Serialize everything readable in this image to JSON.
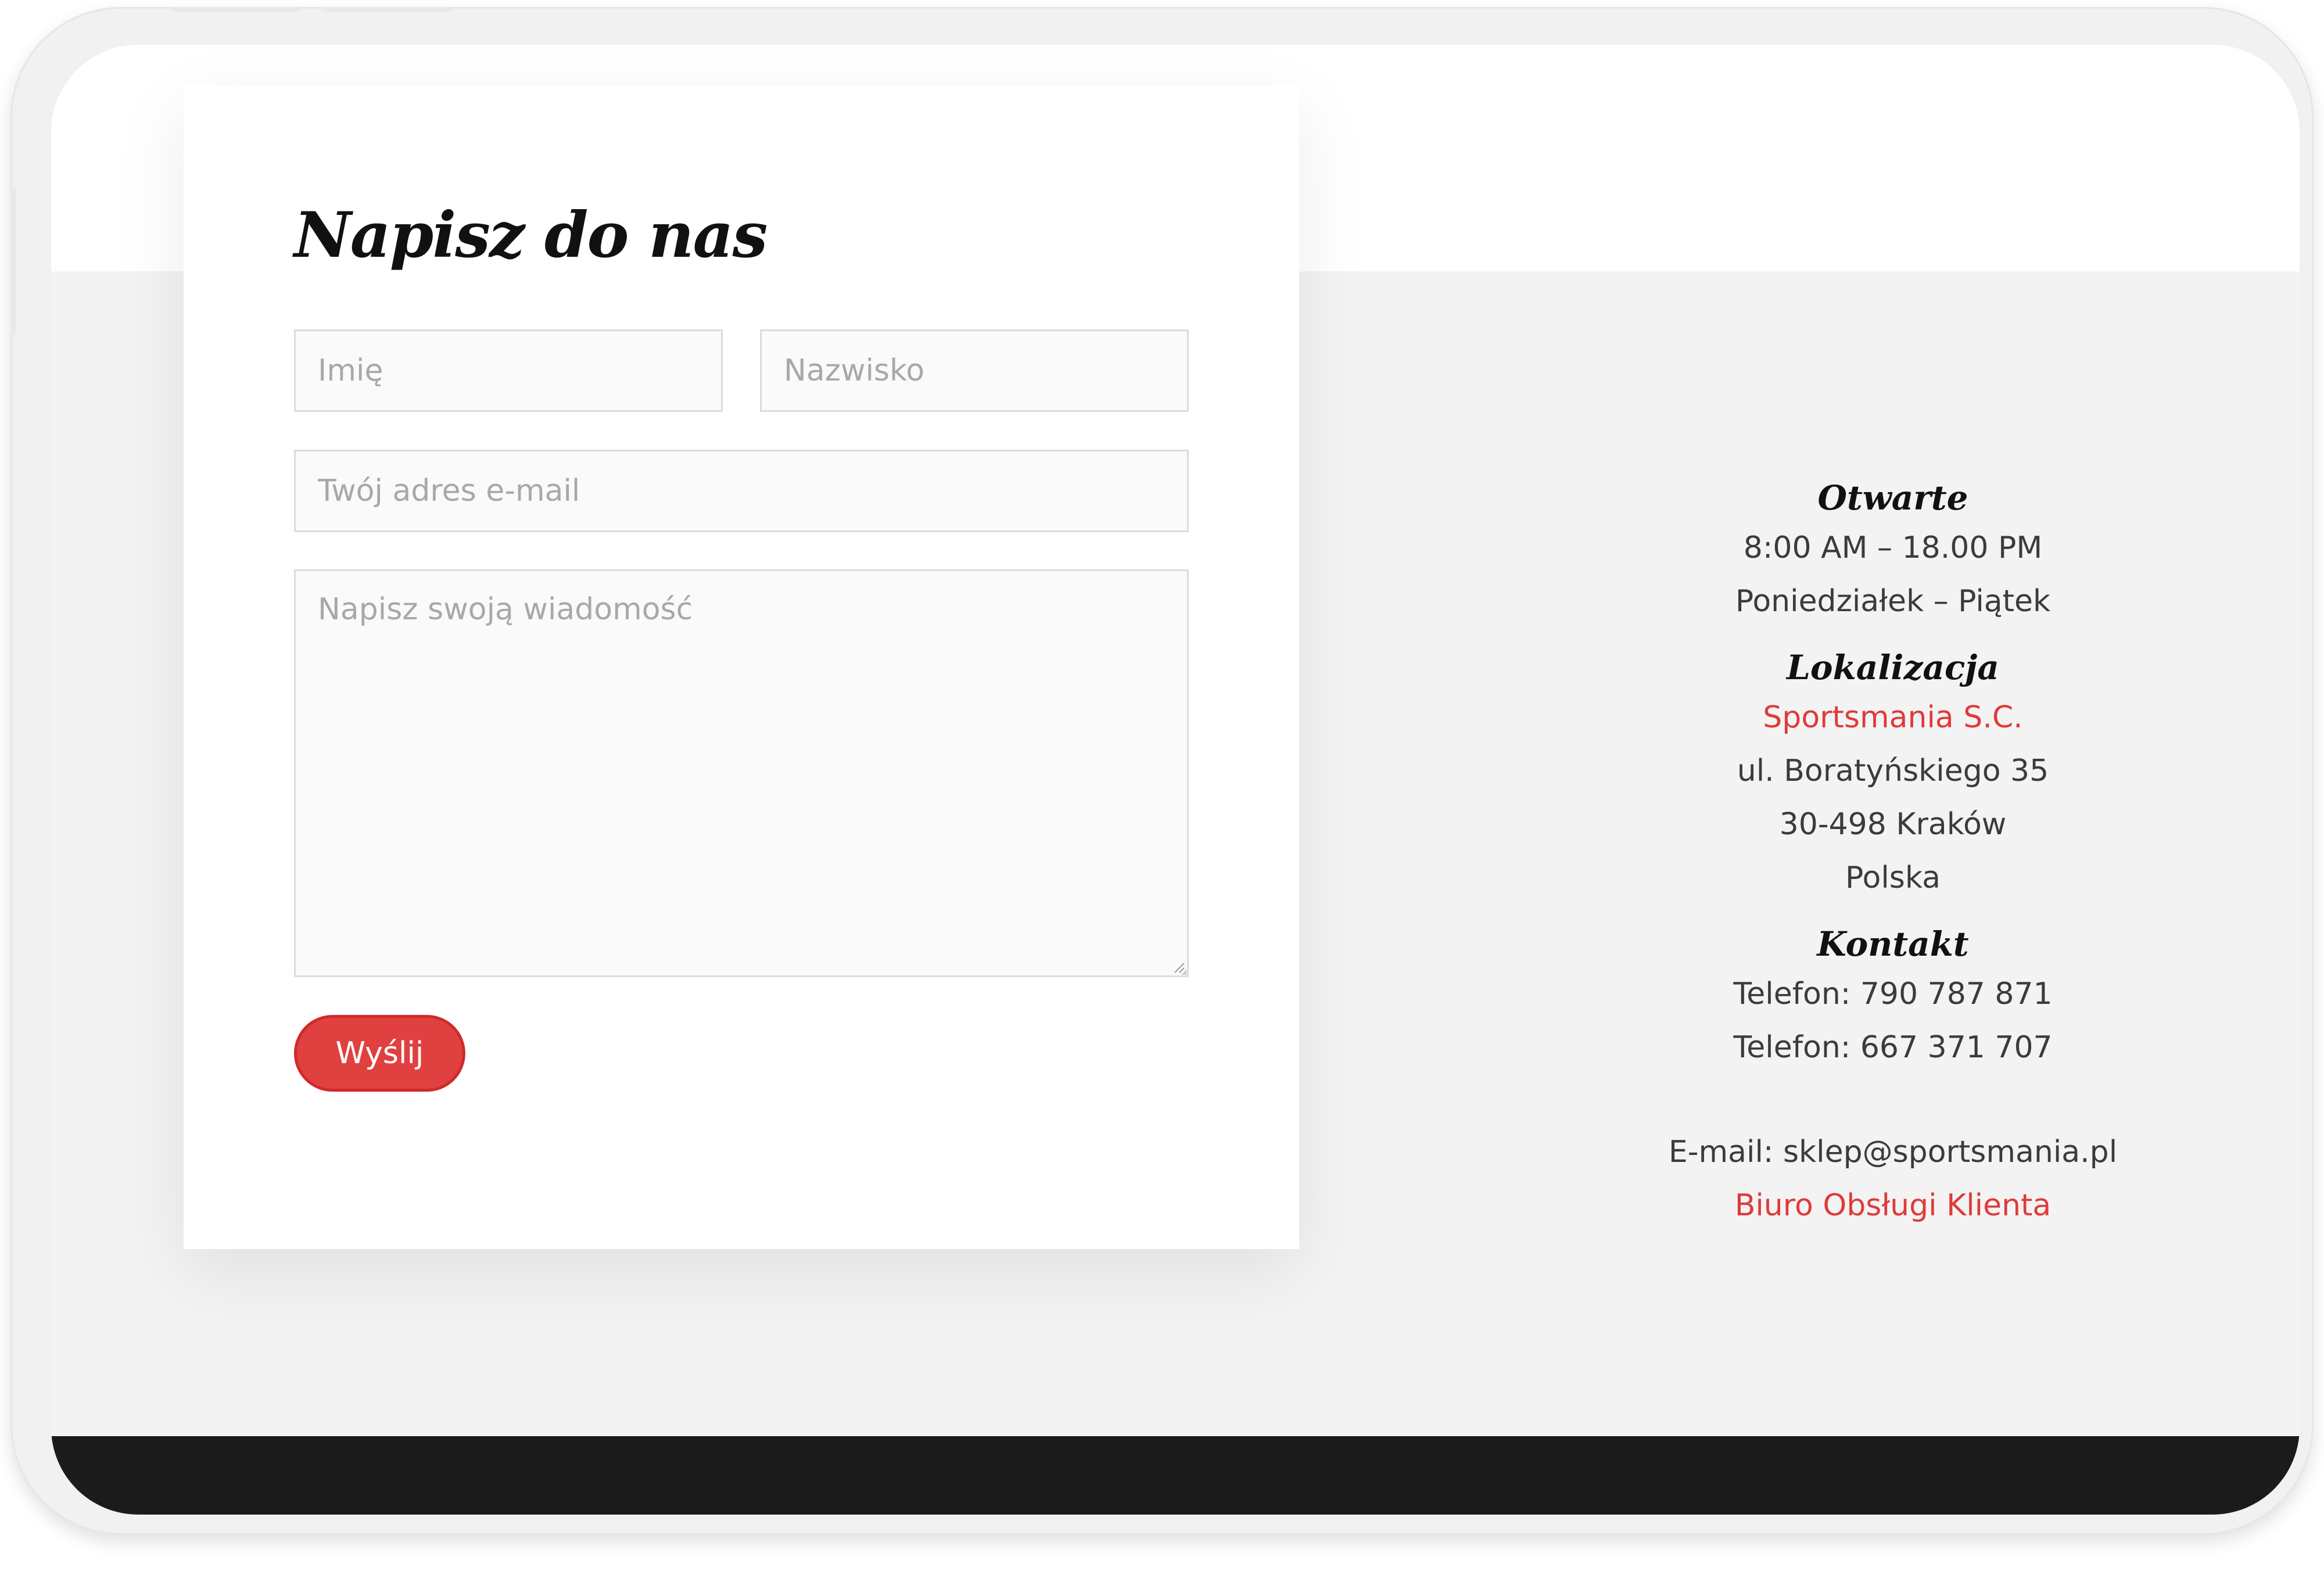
{
  "form": {
    "title": "Napisz do nas",
    "first_name_placeholder": "Imię",
    "last_name_placeholder": "Nazwisko",
    "email_placeholder": "Twój adres e-mail",
    "message_placeholder": "Napisz swoją wiadomość",
    "submit_label": "Wyślij"
  },
  "info": {
    "hours_heading": "Otwarte",
    "hours_time": "8:00 AM – 18.00 PM",
    "hours_days": "Poniedziałek – Piątek",
    "location_heading": "Lokalizacja",
    "company_name": "Sportsmania S.C.",
    "street": "ul. Boratyńskiego 35",
    "city": "30-498 Kraków",
    "country": "Polska",
    "contact_heading": "Kontakt",
    "phone_1": "Telefon: 790 787 871",
    "phone_2": "Telefon: 667 371 707",
    "email": "E-mail: sklep@sportsmania.pl",
    "support_link": "Biuro Obsługi Klienta"
  },
  "colors": {
    "accent": "#e04040",
    "link": "#e03a3a",
    "footer": "#1b1b1b",
    "background": "#f3f3f3"
  }
}
